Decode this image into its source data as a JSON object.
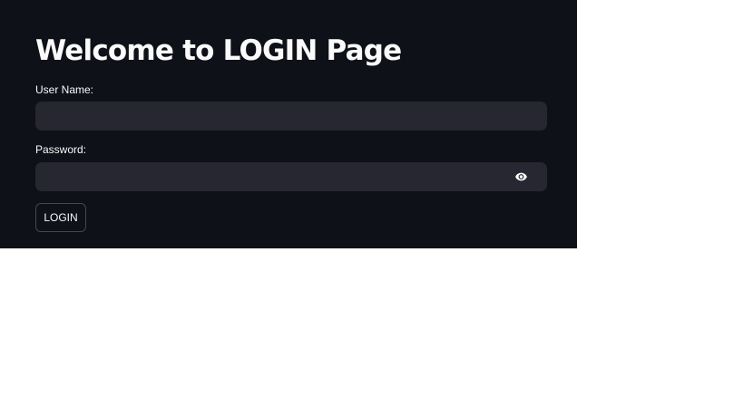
{
  "page": {
    "title": "Welcome to LOGIN Page"
  },
  "form": {
    "username": {
      "label": "User Name:",
      "value": ""
    },
    "password": {
      "label": "Password:",
      "value": "",
      "toggle_icon": "eye-icon"
    },
    "login_button_label": "LOGIN"
  },
  "colors": {
    "background": "#0e1117",
    "input_background": "#262730",
    "text": "#fafafa",
    "button_border": "#45474f"
  }
}
